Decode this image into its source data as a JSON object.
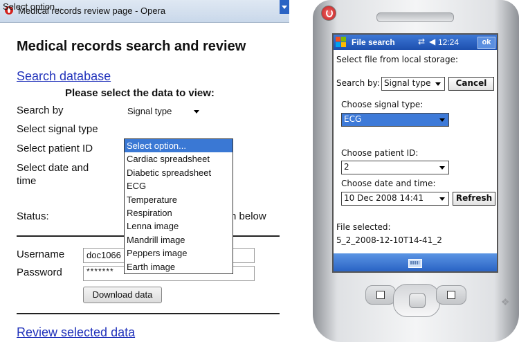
{
  "browser": {
    "window_title": "Medical records review page - Opera",
    "page_title": "Medical records search and review",
    "search_link": "Search database",
    "subheading": "Please select the data to view:",
    "labels": {
      "search_by": "Search by",
      "select_signal_type": "Select signal type",
      "select_patient_id": "Select patient ID",
      "select_date_line1": "Select date and",
      "select_date_line2": "time",
      "status": "Status:",
      "username": "Username",
      "password": "Password"
    },
    "search_by_value": "Signal type",
    "signal_select_value": "Select option...",
    "signal_options": [
      "Select option...",
      "Cardiac spreadsheet",
      "Diabetic spreadsheet",
      "ECG",
      "Temperature",
      "Respiration",
      "Lenna image",
      "Mandrill image",
      "Peppers image",
      "Earth image"
    ],
    "highlighted_option_index": 0,
    "status_tail_text": "n below",
    "username_value": "doc1066",
    "password_value": "*******",
    "download_button": "Download data",
    "review_link": "Review selected data",
    "colors": {
      "link": "#2233bb",
      "highlight": "#3a78d4"
    }
  },
  "mobile": {
    "app_title": "File search",
    "time": "12:24",
    "ok_label": "ok",
    "prompt": "Select file from local storage:",
    "search_by_label": "Search by:",
    "search_by_value": "Signal type",
    "cancel_button": "Cancel",
    "signal_type_label": "Choose signal type:",
    "signal_type_value": "ECG",
    "patient_id_label": "Choose patient ID:",
    "patient_id_value": "2",
    "date_time_label": "Choose date and time:",
    "date_time_value": "10 Dec 2008 14:41",
    "refresh_button": "Refresh",
    "file_selected_label": "File selected:",
    "file_selected_value": "5_2_2008-12-10T14-41_2",
    "icons": [
      "windows-start-icon",
      "connectivity-icon",
      "volume-icon",
      "keyboard-icon",
      "power-icon",
      "windows-logo-icon"
    ]
  }
}
